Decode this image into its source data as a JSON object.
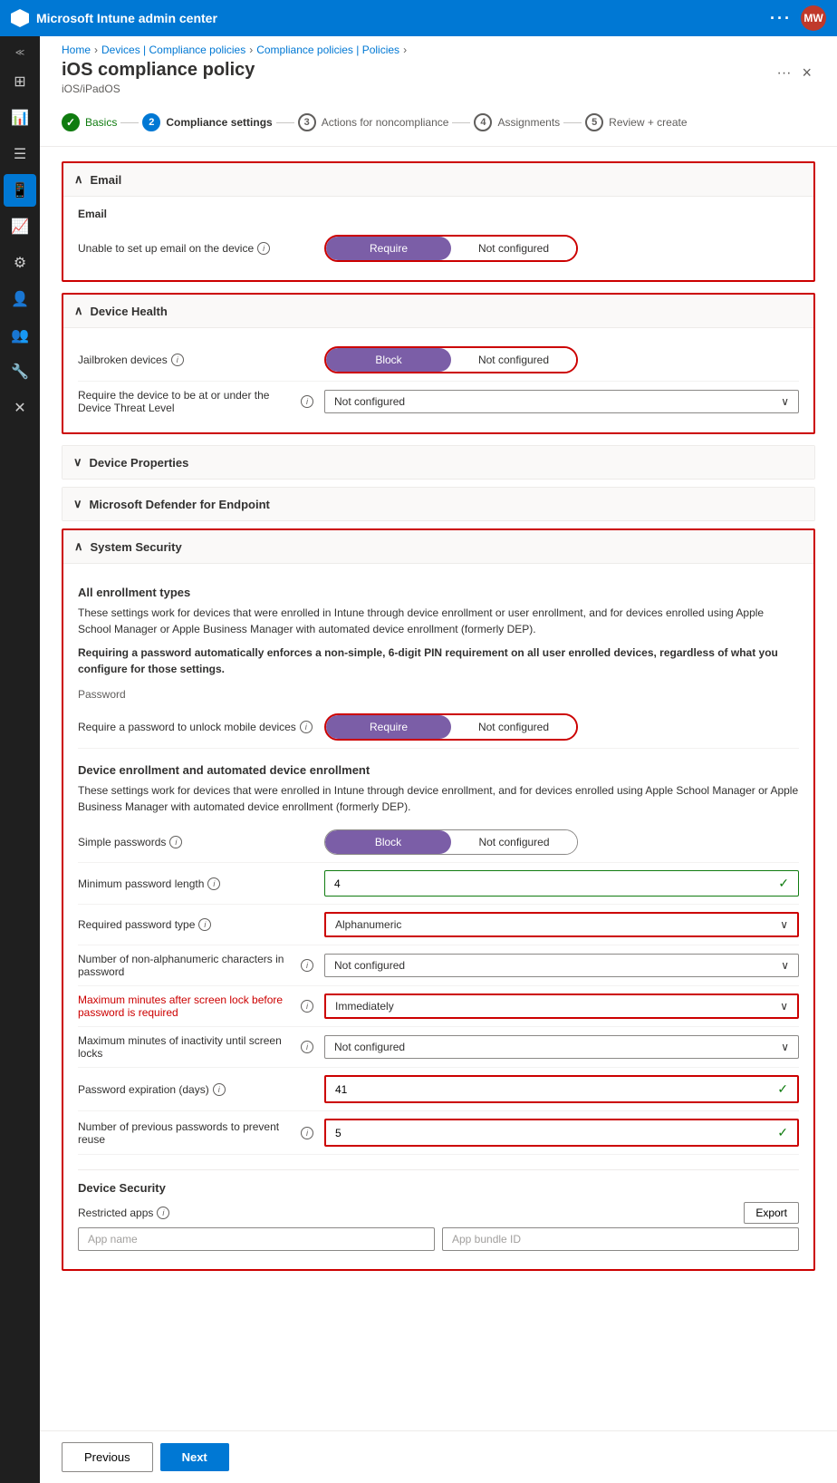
{
  "app": {
    "title": "Microsoft Intune admin center",
    "avatar_text": "MW"
  },
  "breadcrumb": {
    "items": [
      "Home",
      "Devices | Compliance policies",
      "Compliance policies | Policies"
    ]
  },
  "page": {
    "title": "iOS compliance policy",
    "subtitle": "iOS/iPadOS",
    "close_label": "×"
  },
  "wizard": {
    "steps": [
      {
        "num": "✓",
        "label": "Basics",
        "state": "completed"
      },
      {
        "num": "2",
        "label": "Compliance settings",
        "state": "active"
      },
      {
        "num": "3",
        "label": "Actions for noncompliance",
        "state": "inactive"
      },
      {
        "num": "4",
        "label": "Assignments",
        "state": "inactive"
      },
      {
        "num": "5",
        "label": "Review + create",
        "state": "inactive"
      }
    ]
  },
  "sections": {
    "email": {
      "title": "Email",
      "expanded": true,
      "fields": [
        {
          "label": "Unable to set up email on the device",
          "type": "toggle",
          "active": "Require",
          "inactive": "Not configured"
        }
      ]
    },
    "device_health": {
      "title": "Device Health",
      "expanded": true,
      "fields": [
        {
          "label": "Jailbroken devices",
          "type": "toggle",
          "active": "Block",
          "inactive": "Not configured"
        },
        {
          "label": "Require the device to be at or under the Device Threat Level",
          "type": "dropdown",
          "value": "Not configured"
        }
      ]
    },
    "device_properties": {
      "title": "Device Properties",
      "expanded": false
    },
    "defender": {
      "title": "Microsoft Defender for Endpoint",
      "expanded": false
    },
    "system_security": {
      "title": "System Security",
      "expanded": true,
      "enrollment_types_title": "All enrollment types",
      "enrollment_desc1": "These settings work for devices that were enrolled in Intune through device enrollment or user enrollment, and for devices enrolled using Apple School Manager or Apple Business Manager with automated device enrollment (formerly DEP).",
      "enrollment_desc2": "Requiring a password automatically enforces a non-simple, 6-digit PIN requirement on all user enrolled devices, regardless of what you configure for those settings.",
      "password_section_title": "Password",
      "password_field": {
        "label": "Require a password to unlock mobile devices",
        "type": "toggle",
        "active": "Require",
        "inactive": "Not configured"
      },
      "device_enrollment_title": "Device enrollment and automated device enrollment",
      "device_enrollment_desc": "These settings work for devices that were enrolled in Intune through device enrollment, and for devices enrolled using Apple School Manager or Apple Business Manager with automated device enrollment (formerly DEP).",
      "enrollment_fields": [
        {
          "label": "Simple passwords",
          "type": "toggle",
          "active": "Block",
          "inactive": "Not configured"
        },
        {
          "label": "Minimum password length",
          "type": "input_check",
          "value": "4"
        },
        {
          "label": "Required password type",
          "type": "dropdown",
          "value": "Alphanumeric"
        },
        {
          "label": "Number of non-alphanumeric characters in password",
          "type": "dropdown",
          "value": "Not configured"
        },
        {
          "label": "Maximum minutes after screen lock before password is required",
          "type": "dropdown",
          "value": "Immediately",
          "outlined": true
        },
        {
          "label": "Maximum minutes of inactivity until screen locks",
          "type": "dropdown",
          "value": "Not configured"
        },
        {
          "label": "Password expiration (days)",
          "type": "input_check",
          "value": "41",
          "outlined": true
        },
        {
          "label": "Number of previous passwords to prevent reuse",
          "type": "input_check",
          "value": "5",
          "outlined": true
        }
      ],
      "device_security_title": "Device Security",
      "restricted_apps_label": "Restricted apps",
      "export_label": "Export",
      "app_name_placeholder": "App name",
      "app_bundle_placeholder": "App bundle ID"
    }
  },
  "nav": {
    "previous_label": "Previous",
    "next_label": "Next"
  },
  "sidebar_items": [
    {
      "icon": "⊞",
      "name": "home",
      "active": false
    },
    {
      "icon": "📊",
      "name": "dashboard",
      "active": false
    },
    {
      "icon": "☰",
      "name": "menu",
      "active": false
    },
    {
      "icon": "📱",
      "name": "devices",
      "active": true
    },
    {
      "icon": "🔒",
      "name": "security",
      "active": false
    },
    {
      "icon": "⚙",
      "name": "apps",
      "active": false
    },
    {
      "icon": "👤",
      "name": "users",
      "active": false
    },
    {
      "icon": "👥",
      "name": "groups",
      "active": false
    },
    {
      "icon": "🔧",
      "name": "settings",
      "active": false
    },
    {
      "icon": "✕",
      "name": "close",
      "active": false
    }
  ]
}
